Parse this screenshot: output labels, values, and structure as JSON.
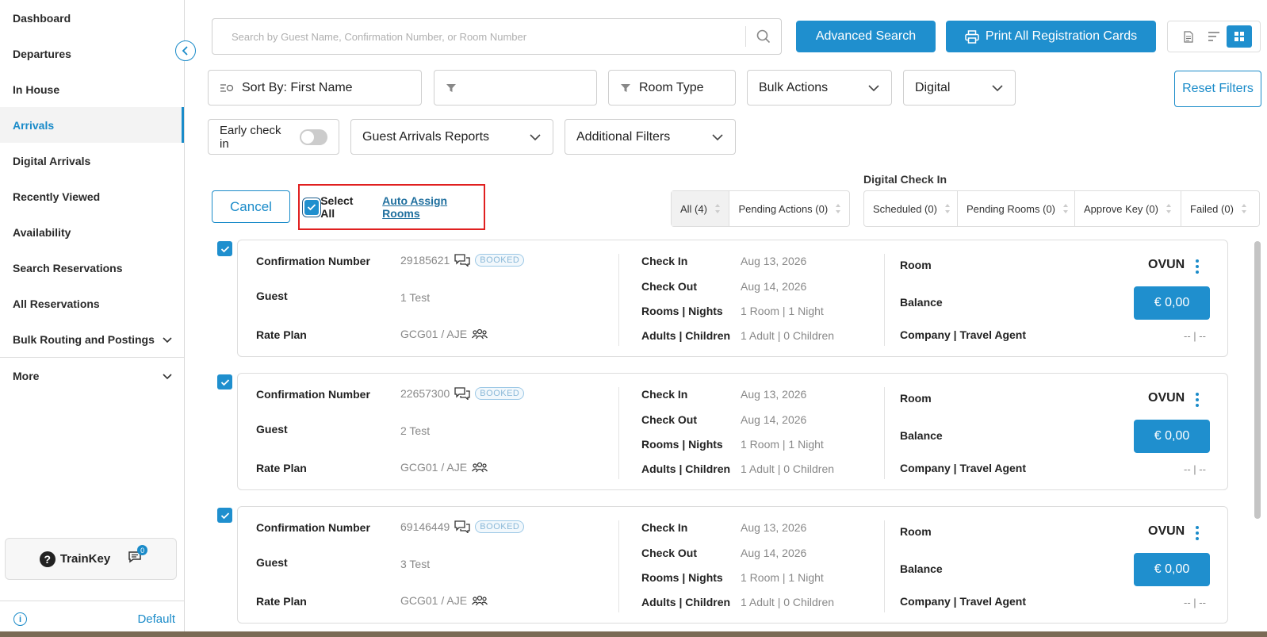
{
  "sidebar": {
    "items": [
      {
        "label": "Dashboard"
      },
      {
        "label": "Departures"
      },
      {
        "label": "In House"
      },
      {
        "label": "Arrivals"
      },
      {
        "label": "Digital Arrivals"
      },
      {
        "label": "Recently Viewed"
      },
      {
        "label": "Availability"
      },
      {
        "label": "Search Reservations"
      },
      {
        "label": "All Reservations"
      },
      {
        "label": "Bulk Routing and Postings"
      },
      {
        "label": "More"
      }
    ],
    "trainkey_label": "TrainKey",
    "chat_badge": "0",
    "footer_default": "Default"
  },
  "toolbar": {
    "search_placeholder": "Search by Guest Name, Confirmation Number, or Room Number",
    "advanced_search": "Advanced Search",
    "print_all": "Print All Registration Cards"
  },
  "filters": {
    "sort_by": "Sort By: First Name",
    "filter_empty": "",
    "room_type": "Room Type",
    "bulk_actions": "Bulk Actions",
    "digital": "Digital",
    "reset": "Reset Filters",
    "early_check_in": "Early check in",
    "guest_arrivals_reports": "Guest Arrivals Reports",
    "additional_filters": "Additional Filters"
  },
  "selection": {
    "cancel": "Cancel",
    "select_all": "Select All",
    "auto_assign": "Auto Assign Rooms"
  },
  "status_tabs": [
    {
      "label": "All (4)"
    },
    {
      "label": "Pending Actions (0)"
    }
  ],
  "digital_check_in": {
    "title": "Digital Check In",
    "tabs": [
      {
        "label": "Scheduled (0)"
      },
      {
        "label": "Pending Rooms (0)"
      },
      {
        "label": "Approve Key (0)"
      },
      {
        "label": "Failed (0)"
      }
    ]
  },
  "labels": {
    "confirmation_number": "Confirmation Number",
    "guest": "Guest",
    "rate_plan": "Rate Plan",
    "check_in": "Check In",
    "check_out": "Check Out",
    "rooms_nights": "Rooms | Nights",
    "adults_children": "Adults | Children",
    "room": "Room",
    "balance": "Balance",
    "company_travel_agent": "Company | Travel Agent"
  },
  "reservations": [
    {
      "confirmation": "29185621",
      "status": "BOOKED",
      "guest": "1 Test",
      "rate_plan": "GCG01 / AJE",
      "check_in": "Aug 13, 2026",
      "check_out": "Aug 14, 2026",
      "rooms_nights": "1 Room | 1 Night",
      "adults_children": "1 Adult | 0 Children",
      "room": "OVUN",
      "balance": "€ 0,00",
      "company": "-- | --"
    },
    {
      "confirmation": "22657300",
      "status": "BOOKED",
      "guest": "2 Test",
      "rate_plan": "GCG01 / AJE",
      "check_in": "Aug 13, 2026",
      "check_out": "Aug 14, 2026",
      "rooms_nights": "1 Room | 1 Night",
      "adults_children": "1 Adult | 0 Children",
      "room": "OVUN",
      "balance": "€ 0,00",
      "company": "-- | --"
    },
    {
      "confirmation": "69146449",
      "status": "BOOKED",
      "guest": "3 Test",
      "rate_plan": "GCG01 / AJE",
      "check_in": "Aug 13, 2026",
      "check_out": "Aug 14, 2026",
      "rooms_nights": "1 Room | 1 Night",
      "adults_children": "1 Adult | 0 Children",
      "room": "OVUN",
      "balance": "€ 0,00",
      "company": "-- | --"
    }
  ],
  "colors": {
    "accent": "#1f8fce",
    "highlight": "#e02020"
  }
}
